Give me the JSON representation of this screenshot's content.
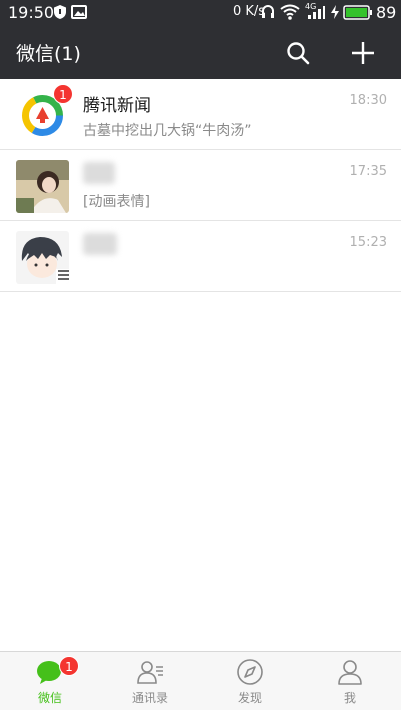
{
  "status_bar": {
    "time": "19:50",
    "network_speed": "0 K/s",
    "network_type": "4G",
    "battery": "89",
    "battery_color": "#35c22b",
    "icons": [
      "shield-icon",
      "gallery-icon",
      "headset-icon",
      "wifi-icon",
      "signal-icon",
      "charging-icon",
      "battery-icon"
    ]
  },
  "app_bar": {
    "title": "微信(1)",
    "icons": [
      "search-icon",
      "plus-icon"
    ]
  },
  "chats": [
    {
      "name": "腾讯新闻",
      "preview": "古墓中挖出几大锅“牛肉汤”",
      "time": "18:30",
      "unread": "1",
      "avatar": "tencent-news-logo"
    },
    {
      "name": "",
      "preview": "[动画表情]",
      "time": "17:35",
      "unread": "",
      "avatar": "photo-avatar"
    },
    {
      "name": "",
      "preview": "",
      "time": "15:23",
      "unread": "",
      "avatar": "anime-avatar"
    }
  ],
  "tabs": [
    {
      "label": "微信",
      "icon": "chat-bubble-icon",
      "active": true,
      "badge": "1"
    },
    {
      "label": "通讯录",
      "icon": "contacts-icon",
      "active": false,
      "badge": ""
    },
    {
      "label": "发现",
      "icon": "compass-icon",
      "active": false,
      "badge": ""
    },
    {
      "label": "我",
      "icon": "person-icon",
      "active": false,
      "badge": ""
    }
  ],
  "colors": {
    "header_bg": "#2e2f33",
    "accent_green": "#45c01a",
    "badge_red": "#f43530"
  }
}
